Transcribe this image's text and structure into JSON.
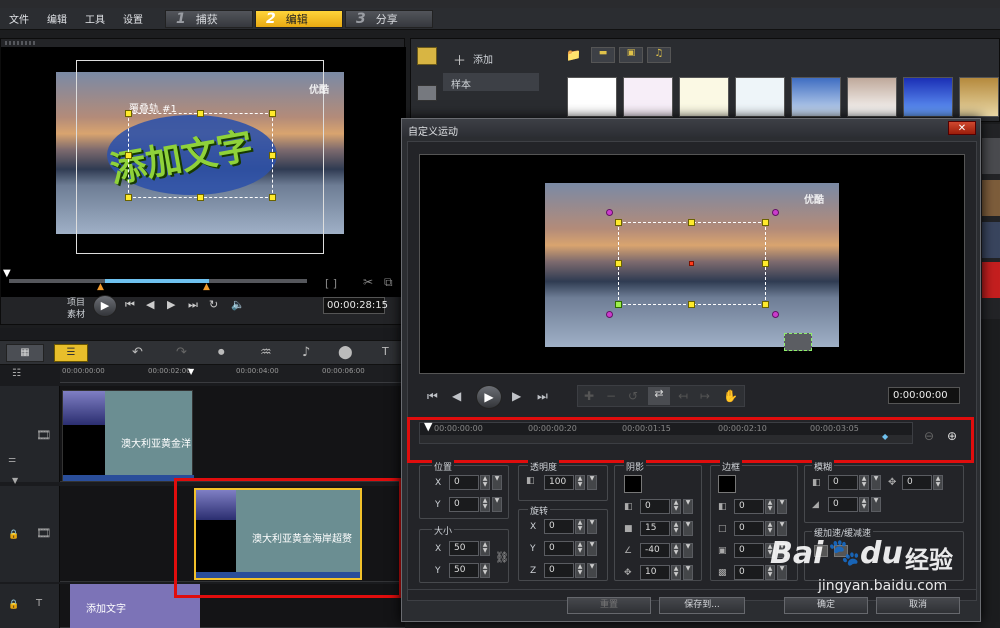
{
  "menu": [
    "文件",
    "编辑",
    "工具",
    "设置"
  ],
  "steps": [
    {
      "num": "1",
      "label": "捕获"
    },
    {
      "num": "2",
      "label": "编辑"
    },
    {
      "num": "3",
      "label": "分享"
    }
  ],
  "preview": {
    "overlay_text": "添加文字",
    "track_label": "覆叠轨 #1",
    "watermark": "优酷",
    "mode_project": "项目",
    "mode_clip": "素材",
    "timecode": "00:00:28:15"
  },
  "library": {
    "add_label": "添加",
    "sample_label": "样本"
  },
  "timeline": {
    "ruler": [
      "00:00:00:00",
      "00:00:02:00",
      "00:00:04:00",
      "00:00:06:00"
    ],
    "clip1_label": "澳大利亚黄金洋",
    "clip2_label": "澳大利亚黄金海岸超赘",
    "title_clip_label": "添加文字"
  },
  "dialog": {
    "title": "自定义运动",
    "close": "✕",
    "watermark": "优酷",
    "timecode": "0:00:00:00",
    "track_ruler": [
      "00:00:00:00",
      "00:00:00:20",
      "00:00:01:15",
      "00:00:02:10",
      "00:00:03:05"
    ],
    "position": {
      "label": "位置",
      "x_label": "X",
      "x": "0",
      "y_label": "Y",
      "y": "0"
    },
    "transparency": {
      "label": "透明度",
      "value": "100"
    },
    "rotation": {
      "label": "旋转",
      "x_label": "X",
      "x": "0",
      "y_label": "Y",
      "y": "0",
      "z_label": "Z",
      "z": "0"
    },
    "size": {
      "label": "大小",
      "x_label": "X",
      "x": "50",
      "y_label": "Y",
      "y": "50"
    },
    "shadow": {
      "label": "阴影",
      "v1": "0",
      "v2": "15",
      "v3": "-40",
      "v4": "10"
    },
    "border": {
      "label": "边框",
      "v1": "0",
      "v2": "0",
      "v3": "0",
      "v4": "0"
    },
    "blur": {
      "label": "模糊",
      "v1": "0",
      "v2": "0",
      "v3": "0"
    },
    "ease_label": "缓加速/缓减速",
    "reset": "重置",
    "save_to": "保存到...",
    "ok": "确定",
    "cancel": "取消"
  },
  "baidu": {
    "brand": "Bai",
    "brand2": "du",
    "jingyan": "经验",
    "url": "jingyan.baidu.com"
  }
}
